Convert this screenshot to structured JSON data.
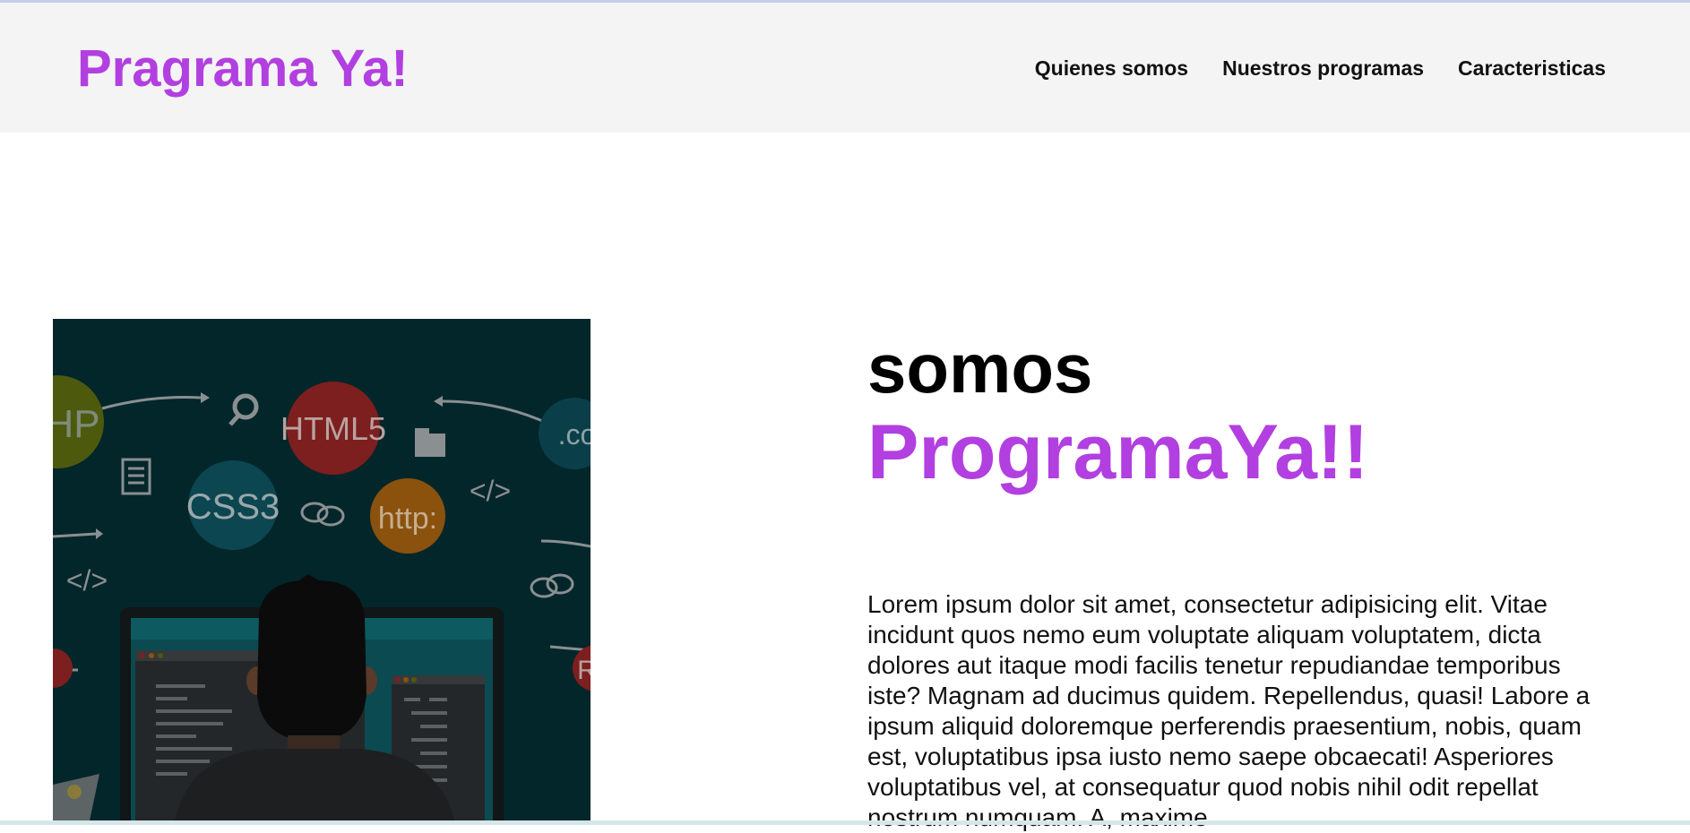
{
  "brand": {
    "title": "Pragrama Ya!"
  },
  "nav": {
    "items": [
      {
        "label": "Quienes somos"
      },
      {
        "label": "Nuestros programas"
      },
      {
        "label": "Caracteristicas"
      }
    ]
  },
  "hero": {
    "image": {
      "badges": {
        "php": "HP",
        "html5": "HTML5",
        "css3": "CSS3",
        "http": "http:",
        "com": ".co",
        "code_tag": "</>",
        "r": "R"
      }
    },
    "headline_line1": "somos",
    "headline_line2": "ProgramaYa!!",
    "body": "Lorem ipsum dolor sit amet, consectetur adipisicing elit. Vitae incidunt quos nemo eum voluptate aliquam voluptatem, dicta dolores aut itaque modi facilis tenetur repudiandae temporibus iste? Magnam ad ducimus quidem. Repellendus, quasi! Labore a ipsum aliquid doloremque perferendis praesentium, nobis, quam est, voluptatibus ipsa iusto nemo saepe obcaecati! Asperiores voluptatibus vel, at consequatur quod nobis nihil odit repellat nostrum numquam. A, maxime"
  },
  "colors": {
    "accent": "#b23fe0",
    "header_bg": "#f4f4f4",
    "image_bg": "#03262a"
  }
}
